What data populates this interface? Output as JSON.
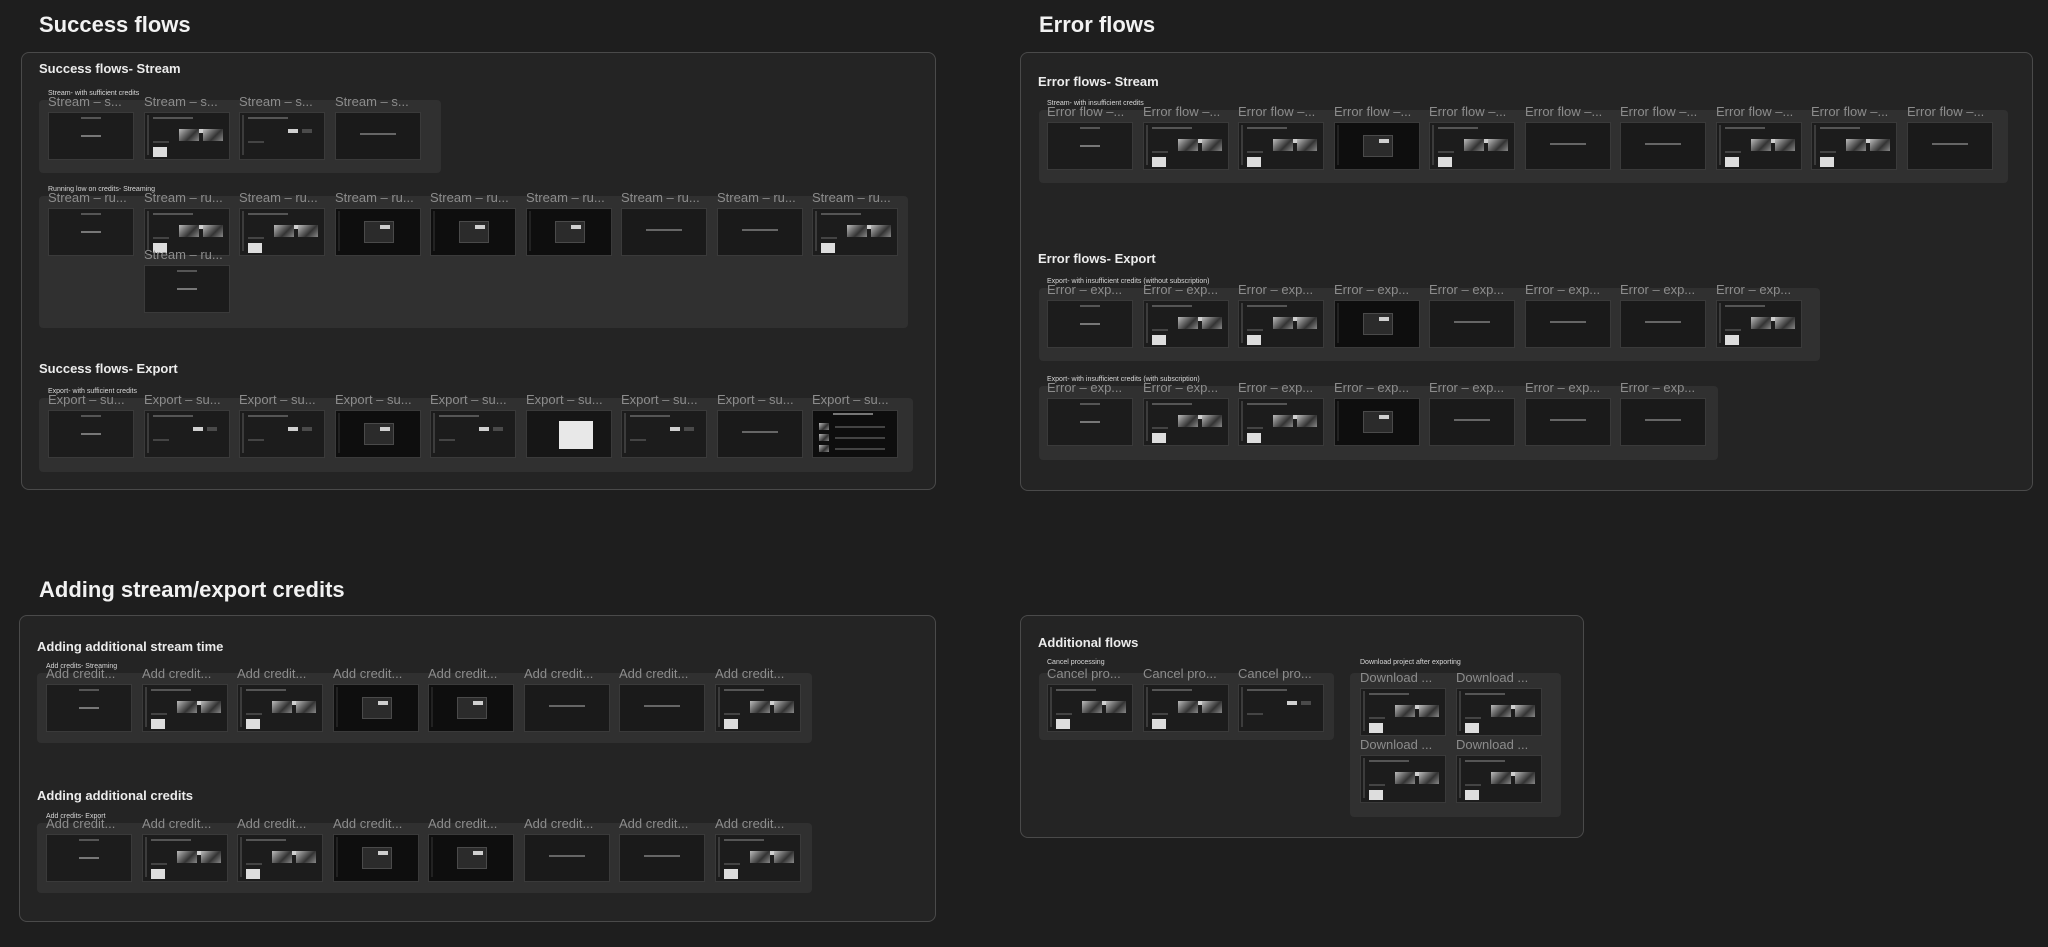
{
  "sections": {
    "success": {
      "title": "Success flows"
    },
    "error": {
      "title": "Error flows"
    },
    "credits": {
      "title": "Adding stream/export credits"
    }
  },
  "panels": {
    "success_stream": "Success flows- Stream",
    "success_export": "Success flows- Export",
    "error_stream": "Error flows- Stream",
    "error_export": "Error flows- Export",
    "add_stream_time": "Adding additional stream time",
    "add_credits": "Adding additional credits",
    "additional": "Additional flows"
  },
  "groups": {
    "stream_sufficient": "Stream- with sufficient credits",
    "running_low": "Running low on credits- Streaming",
    "export_sufficient": "Export- with sufficient credits",
    "stream_insufficient": "Stream- with insufficient credits",
    "export_no_sub": "Export- with insufficient credits (without subscription)",
    "export_with_sub": "Export- with insufficient credits (with subscription)",
    "add_streaming": "Add credits- Streaming",
    "add_export": "Add credits- Export",
    "cancel_processing": "Cancel processing",
    "download_after": "Download project after exporting"
  },
  "frame_labels": {
    "stream_s": "Stream – s...",
    "stream_ru": "Stream – ru...",
    "export_su": "Export – su...",
    "error_flow": "Error flow –...",
    "error_exp": "Error – exp...",
    "add_credit": "Add credit...",
    "cancel_pro": "Cancel pro...",
    "download": "Download ..."
  }
}
